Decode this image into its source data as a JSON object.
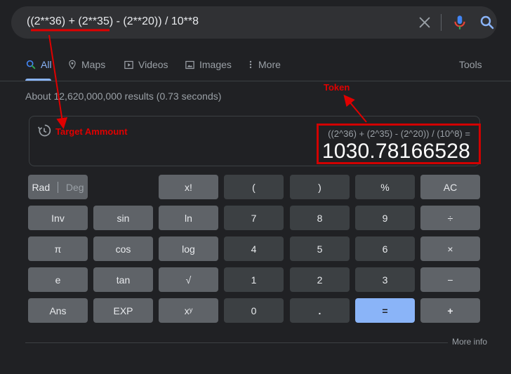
{
  "search": {
    "query": "((2**36) + (2**35) - (2**20)) / 10**8"
  },
  "tabs": [
    {
      "label": "All",
      "icon": "search-icon",
      "active": true
    },
    {
      "label": "Maps",
      "icon": "map-pin-icon"
    },
    {
      "label": "Videos",
      "icon": "video-icon"
    },
    {
      "label": "Images",
      "icon": "image-icon"
    },
    {
      "label": "More",
      "icon": "more-vert-icon"
    }
  ],
  "tools_label": "Tools",
  "result_stats": "About 12,620,000,000 results (0.73 seconds)",
  "calculator": {
    "expression": "((2^36) + (2^35) - (2^20)) / (10^8) =",
    "result": "1030.78166528",
    "keys": {
      "rad": "Rad",
      "deg": "Deg",
      "fact": "x!",
      "lparen": "(",
      "rparen": ")",
      "percent": "%",
      "ac": "AC",
      "inv": "Inv",
      "sin": "sin",
      "ln": "ln",
      "seven": "7",
      "eight": "8",
      "nine": "9",
      "divide": "÷",
      "pi": "π",
      "cos": "cos",
      "log": "log",
      "four": "4",
      "five": "5",
      "six": "6",
      "multiply": "×",
      "e": "e",
      "tan": "tan",
      "sqrt": "√",
      "one": "1",
      "two": "2",
      "three": "3",
      "minus": "−",
      "ans": "Ans",
      "exp": "EXP",
      "power": "xʸ",
      "zero": "0",
      "dot": ".",
      "equals": "=",
      "plus": "+"
    }
  },
  "more_info": "More info",
  "annotations": {
    "target": "Target Ammount",
    "token": "Token"
  },
  "colors": {
    "background": "#202124",
    "accent": "#8ab4f8",
    "annotation": "#e00000"
  }
}
